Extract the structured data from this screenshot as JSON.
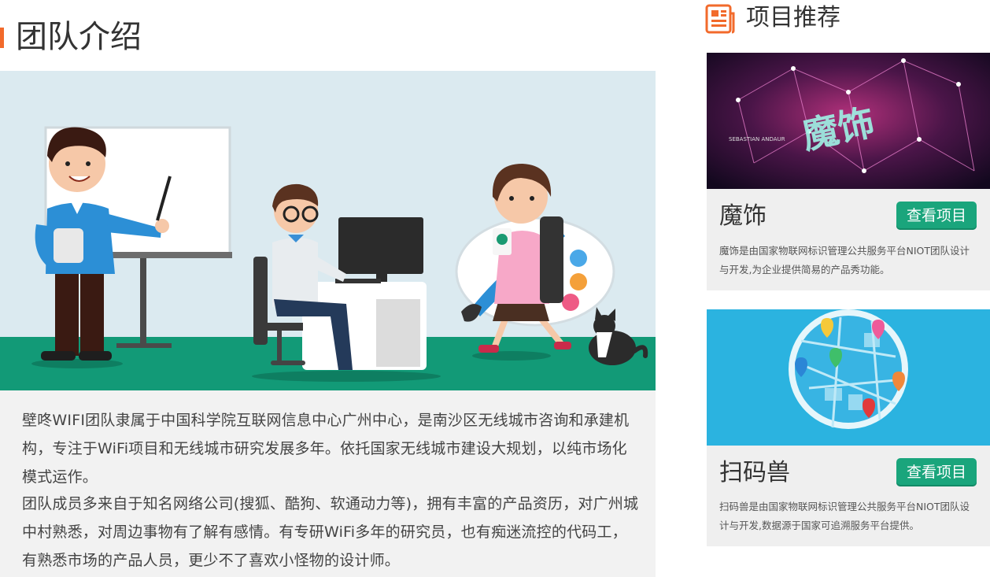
{
  "team": {
    "title": "团队介绍",
    "paragraphs": [
      "壁咚WIFI团队隶属于中国科学院互联网信息中心广州中心，是南沙区无线城市咨询和承建机构，专注于WiFi项目和无线城市研究发展多年。依托国家无线城市建设大规划，以纯市场化模式运作。",
      "团队成员多来自于知名网络公司(搜狐、酷狗、软通动力等)，拥有丰富的产品资历，对广州城中村熟悉，对周边事物有了解有感情。有专研WiFi多年的研究员，也有痴迷流控的代码工，有熟悉市场的产品人员，更少不了喜欢小怪物的设计师。"
    ]
  },
  "recommend": {
    "title": "项目推荐",
    "icon": "document-icon",
    "accent": "#f26a2b",
    "projects": [
      {
        "name": "魔饰",
        "button": "查看项目",
        "description": "魔饰是由国家物联网标识管理公共服务平台NIOT团队设计与开发,为企业提供简易的产品秀功能。",
        "image_text": "SEBASTIAN ANDAUR"
      },
      {
        "name": "扫码兽",
        "button": "查看项目",
        "description": "扫码兽是由国家物联网标识管理公共服务平台NIOT团队设计与开发,数据源于国家可追溯服务平台提供。"
      }
    ],
    "button_color": "#1aa57c"
  }
}
